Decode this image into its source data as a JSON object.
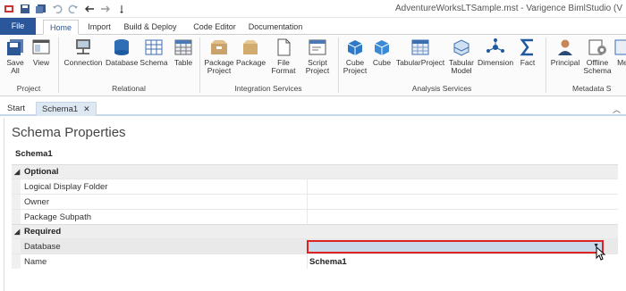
{
  "window": {
    "title": "AdventureWorksLTSample.mst - Varigence BimlStudio (V"
  },
  "ribbon_tabs": [
    "File",
    "Home",
    "Import",
    "Build & Deploy",
    "Code Editor",
    "Documentation"
  ],
  "groups": {
    "project": "Project",
    "relational": "Relational",
    "integration": "Integration Services",
    "analysis": "Analysis Services",
    "metadata": "Metadata S"
  },
  "buttons": {
    "save_all": "Save All",
    "view": "View",
    "connection": "Connection",
    "database": "Database",
    "schema": "Schema",
    "table": "Table",
    "package_project": "Package Project",
    "package": "Package",
    "file_format": "File Format",
    "script_project": "Script Project",
    "cube_project": "Cube Project",
    "cube": "Cube",
    "tabular_project": "TabularProject",
    "tabular_model": "Tabular Model",
    "dimension": "Dimension",
    "fact": "Fact",
    "principal": "Principal",
    "offline_schema": "Offline Schema",
    "me": "Me"
  },
  "doc_tabs": {
    "start": "Start",
    "schema": "Schema1"
  },
  "properties": {
    "title": "Schema Properties",
    "object_name": "Schema1",
    "optional_label": "Optional",
    "logical_display_folder": "Logical Display Folder",
    "owner": "Owner",
    "package_subpath": "Package Subpath",
    "required_label": "Required",
    "database": "Database",
    "name": "Name",
    "name_value": "Schema1"
  }
}
